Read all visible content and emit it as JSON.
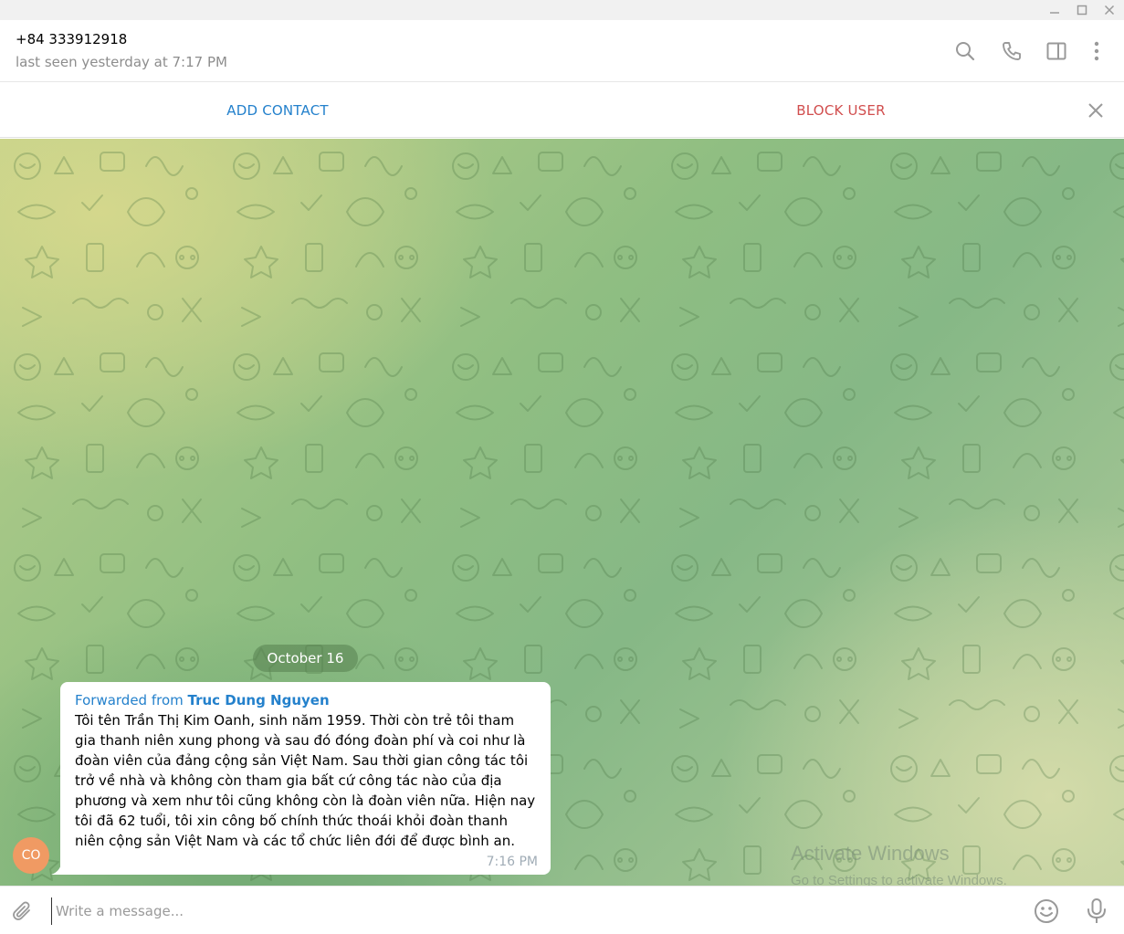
{
  "window": {
    "minimize_glyph": "—",
    "maximize_glyph": "☐",
    "close_glyph": "✕"
  },
  "header": {
    "name": "+84 333912918",
    "status": "last seen yesterday at 7:17 PM",
    "icons": [
      "search-icon",
      "phone-icon",
      "sidebar-toggle-icon",
      "more-vertical-icon"
    ]
  },
  "action_bar": {
    "add_contact": "ADD CONTACT",
    "block_user": "BLOCK USER",
    "close_icon": "close-icon"
  },
  "chat": {
    "date": "October 16",
    "message": {
      "forwarded_prefix": "Forwarded from ",
      "forwarded_name": "Truc Dung Nguyen",
      "text": "Tôi tên Trần Thị Kim Oanh, sinh năm 1959. Thời còn trẻ tôi tham gia thanh niên xung phong và sau đó đóng đoàn phí và coi như là đoàn viên của đảng cộng sản Việt Nam. Sau thời gian công tác tôi trở về nhà và không còn tham gia bất cứ công tác nào của địa phương và xem như tôi cũng không còn là đoàn viên nữa. Hiện nay tôi đã 62 tuổi, tôi xin công bố chính thức thoái khỏi đoàn thanh niên cộng sản Việt Nam và các tổ chức liên đới để được bình an.",
      "time": "7:16 PM"
    },
    "avatar_initials": "CO"
  },
  "watermark": {
    "title": "Activate Windows",
    "subtitle": "Go to Settings to activate Windows."
  },
  "composer": {
    "placeholder": "Write a message...",
    "value": ""
  },
  "colors": {
    "link_blue": "#2481cc",
    "danger_red": "#d14e4e",
    "avatar_orange": "#f09a63"
  }
}
